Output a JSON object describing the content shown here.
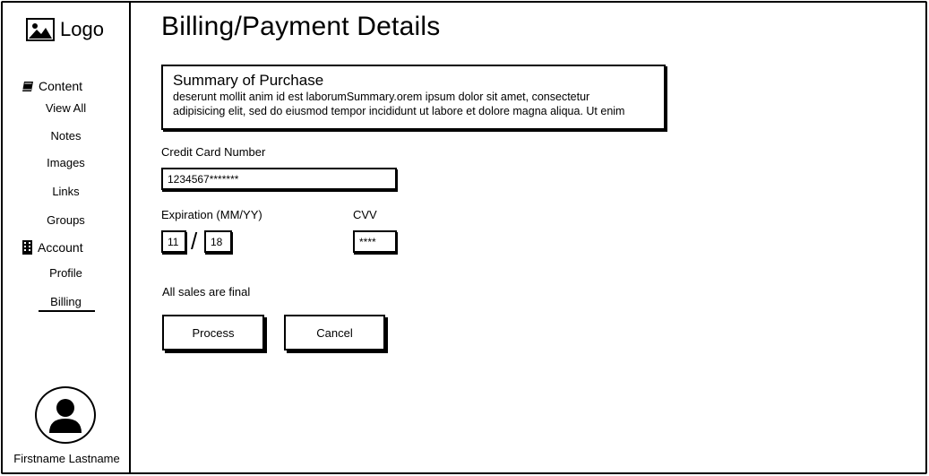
{
  "sidebar": {
    "logo_text": "Logo",
    "content_group_label": "Content",
    "content_items": [
      "View All",
      "Notes",
      "Images",
      "Links",
      "Groups"
    ],
    "account_group_label": "Account",
    "account_items": [
      "Profile",
      "Billing"
    ],
    "active_item": "Billing",
    "user_name": "Firstname Lastname"
  },
  "main": {
    "title": "Billing/Payment Details",
    "summary": {
      "title": "Summary of Purchase",
      "text_line1": "deserunt mollit anim id est laborumSummary.orem ipsum dolor sit amet, consectetur",
      "text_line2": "adipisicing elit, sed do eiusmod tempor incididunt ut labore et dolore magna aliqua. Ut enim"
    },
    "credit_card": {
      "label": "Credit Card Number",
      "value": "1234567*******"
    },
    "expiration": {
      "label": "Expiration (MM/YY)",
      "month": "11",
      "separator": "/",
      "year": "18"
    },
    "cvv": {
      "label": "CVV",
      "value": "****"
    },
    "notice": "All sales are final",
    "buttons": {
      "process": "Process",
      "cancel": "Cancel"
    }
  }
}
